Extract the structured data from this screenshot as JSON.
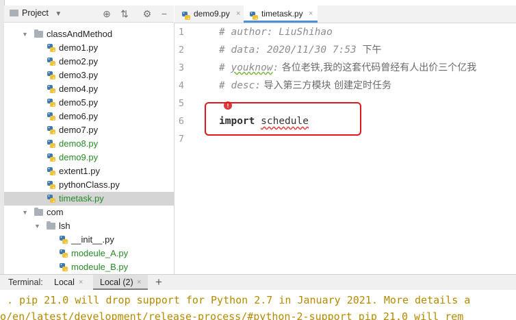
{
  "project_panel": {
    "title": "Project",
    "tools": {
      "target": "⊕",
      "collapse": "⇅",
      "settings": "⚙",
      "hide": "−"
    },
    "tree": [
      {
        "label": "classAndMethod",
        "type": "folder",
        "level": 1,
        "expanded": true
      },
      {
        "label": "demo1.py",
        "type": "py",
        "level": 2
      },
      {
        "label": "demo2.py",
        "type": "py",
        "level": 2
      },
      {
        "label": "demo3.py",
        "type": "py",
        "level": 2
      },
      {
        "label": "demo4.py",
        "type": "py",
        "level": 2
      },
      {
        "label": "demo5.py",
        "type": "py",
        "level": 2
      },
      {
        "label": "demo6.py",
        "type": "py",
        "level": 2
      },
      {
        "label": "demo7.py",
        "type": "py",
        "level": 2
      },
      {
        "label": "demo8.py",
        "type": "py",
        "level": 2,
        "status": "added"
      },
      {
        "label": "demo9.py",
        "type": "py",
        "level": 2,
        "status": "added"
      },
      {
        "label": "extent1.py",
        "type": "py",
        "level": 2
      },
      {
        "label": "pythonClass.py",
        "type": "py",
        "level": 2
      },
      {
        "label": "timetask.py",
        "type": "py",
        "level": 2,
        "status": "added",
        "selected": true
      },
      {
        "label": "com",
        "type": "folder",
        "level": 1,
        "expanded": true
      },
      {
        "label": "lsh",
        "type": "folder",
        "level": 2,
        "expanded": true
      },
      {
        "label": "__init__.py",
        "type": "py",
        "level": 3
      },
      {
        "label": "modeule_A.py",
        "type": "py",
        "level": 3,
        "status": "added"
      },
      {
        "label": "modeule_B.py",
        "type": "py",
        "level": 3,
        "status": "added"
      }
    ]
  },
  "editor": {
    "tabs": [
      {
        "label": "demo9.py",
        "active": false,
        "close": "×"
      },
      {
        "label": "timetask.py",
        "active": true,
        "close": "×"
      }
    ],
    "line_numbers": [
      "1",
      "2",
      "3",
      "4",
      "5",
      "6",
      "7"
    ],
    "lines": {
      "l1_key": "# author:",
      "l1_val": " LiuShihao",
      "l2_key": "# data:",
      "l2_val": " 2020/11/30 7:53 ",
      "l2_cjk": "下午",
      "l3_key": "# ",
      "l3_word": "youknow",
      "l3_colon": ":",
      "l3_cjk": " 各位老铁,我的这套代码曾经有人出价三个亿我",
      "l4_key": "# desc:",
      "l4_cjk": " 导入第三方模块    创建定时任务",
      "l6_kw": "import",
      "l6_mod": "schedule"
    },
    "bulb": "!",
    "current_line": 6
  },
  "terminal": {
    "label": "Terminal:",
    "tabs": [
      {
        "label": "Local",
        "active": false,
        "close": "×"
      },
      {
        "label": "Local (2)",
        "active": true,
        "close": "×"
      }
    ],
    "add": "+",
    "output": [
      ". pip 21.0 will drop support for Python 2.7 in January 2021. More details a",
      "o/en/latest/development/release-process/#python-2-support pip 21.0 will rem"
    ]
  },
  "colors": {
    "highlight_box": "#e0161b",
    "added_file": "#268a26",
    "terminal_text": "#b28a00",
    "active_tab_underline": "#4f8fd8"
  }
}
